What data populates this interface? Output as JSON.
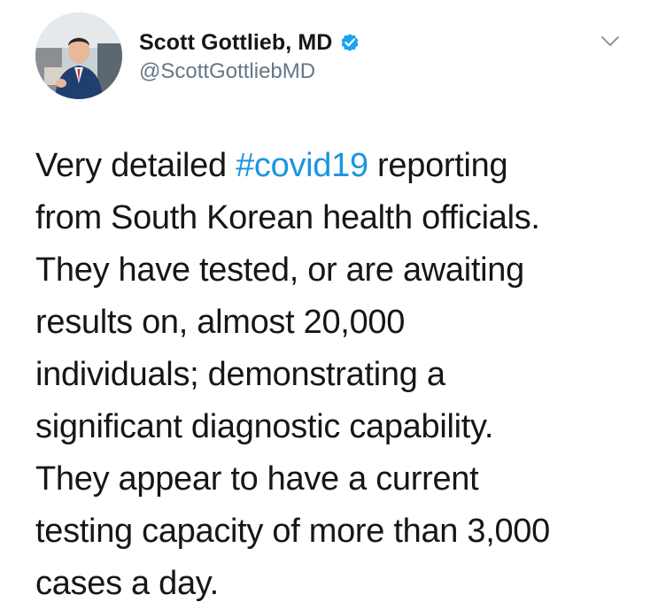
{
  "author": {
    "display_name": "Scott Gottlieb, MD",
    "handle": "@ScottGottliebMD",
    "verified": true
  },
  "icons": {
    "verified": "verified-badge-icon",
    "menu": "chevron-down-icon"
  },
  "colors": {
    "hashtag": "#1b95e0",
    "verified": "#1da1f2",
    "text": "#14171a",
    "handle": "#657786"
  },
  "tweet": {
    "lines": [
      {
        "before": "Very detailed ",
        "hashtag": "#covid19",
        "after": " reporting"
      },
      {
        "text": "from South Korean health officials."
      },
      {
        "text": "They have tested, or are awaiting"
      },
      {
        "text": "results on, almost 20,000"
      },
      {
        "text": "individuals; demonstrating a"
      },
      {
        "text": "significant diagnostic capability."
      },
      {
        "text": "They appear to have a current"
      },
      {
        "text": "testing capacity of more than 3,000"
      },
      {
        "text": "cases a day."
      }
    ]
  }
}
